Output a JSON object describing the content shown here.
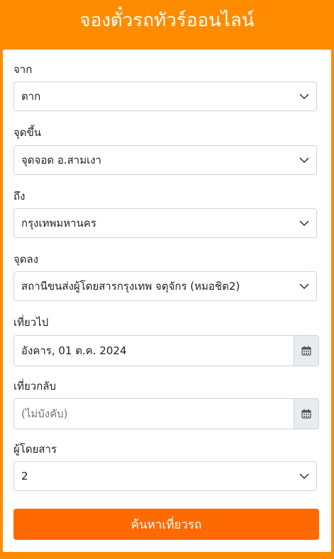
{
  "header": {
    "title": "จองตั๋วรถทัวร์ออนไลน์"
  },
  "form": {
    "from": {
      "label": "จาก",
      "value": "ตาก"
    },
    "pickup": {
      "label": "จุดขึ้น",
      "value": "จุดจอด อ.สามเงา"
    },
    "to": {
      "label": "ถึง",
      "value": "กรุงเทพมหานคร"
    },
    "dropoff": {
      "label": "จุดลง",
      "value": "สถานีขนส่งผู้โดยสารกรุงเทพ จตุจักร (หมอชิต2)"
    },
    "depart": {
      "label": "เที่ยวไป",
      "value": "อังคาร, 01 ต.ค. 2024"
    },
    "return": {
      "label": "เที่ยวกลับ",
      "placeholder": "(ไม่บังคับ)"
    },
    "passengers": {
      "label": "ผู้โดยสาร",
      "value": "2"
    },
    "search_label": "ค้นหาเที่ยวรถ"
  },
  "icons": {
    "dropdown": "chevron-down-icon",
    "calendar": "calendar-icon"
  },
  "colors": {
    "brand_orange": "#ff8c00",
    "button_orange": "#ff6a00"
  }
}
